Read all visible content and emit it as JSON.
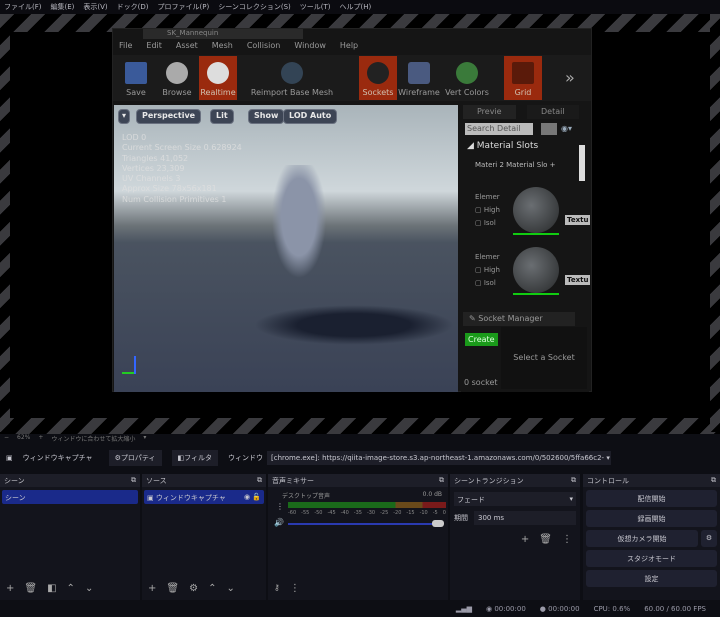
{
  "menubar": [
    "ファイル(F)",
    "編集(E)",
    "表示(V)",
    "ドック(D)",
    "プロファイル(P)",
    "シーンコレクション(S)",
    "ツール(T)",
    "ヘルプ(H)"
  ],
  "ue": {
    "title": "SK_Mannequin",
    "menu": [
      "File",
      "Edit",
      "Asset",
      "Mesh",
      "Collision",
      "Window",
      "Help"
    ],
    "toolbar": [
      {
        "label": "Save",
        "on": false
      },
      {
        "label": "Browse",
        "on": false
      },
      {
        "label": "Realtime",
        "on": true
      },
      {
        "label": "Reimport Base Mesh",
        "on": false
      },
      {
        "label": "Sockets",
        "on": true
      },
      {
        "label": "Wireframe",
        "on": false
      },
      {
        "label": "Vert Colors",
        "on": false
      },
      {
        "label": "Grid",
        "on": true
      }
    ],
    "more": "»",
    "viewport_buttons": {
      "dropdown": "▾",
      "perspective": "Perspective",
      "lit": "Lit",
      "show": "Show",
      "lod": "LOD Auto"
    },
    "stats": [
      "LOD  0",
      "Current Screen Size  0.628924",
      "Triangles  41,052",
      "Vertices  23,309",
      "UV Channels  3",
      "Approx Size  78x56x181",
      "Num Collision Primitives  1"
    ],
    "tabs": [
      "Previe",
      "Detail"
    ],
    "search_placeholder": "Search Detail",
    "material_slots": "Material Slots",
    "materials_label": "Materi",
    "materials_count": "2 Material Slo",
    "element": "Elemer",
    "highlight": "High",
    "isolate": "Isol",
    "texture": "Textu",
    "socket_manager": "Socket Manager",
    "create": "Create",
    "select_socket": "Select a Socket",
    "socket_count": "0 socket"
  },
  "zoombar": {
    "minus": "−",
    "zoom": "62%",
    "plus": "+",
    "fit": "ウィンドウに合わせて拡大縮小",
    "arrow": "▾"
  },
  "sourcebar": {
    "name": "ウィンドウキャプチャ",
    "properties": "プロパティ",
    "filters": "フィルタ",
    "window_label": "ウィンドウ",
    "window_value": "[chrome.exe]: https://qiita-image-store.s3.ap-northeast-1.amazonaws.com/0/502600/5ffa66c2-"
  },
  "docks": {
    "scenes": {
      "title": "シーン",
      "items": [
        "シーン"
      ]
    },
    "sources": {
      "title": "ソース",
      "items": [
        "ウィンドウキャプチャ"
      ]
    },
    "mixer": {
      "title": "音声ミキサー",
      "channel": "デスクトップ音声",
      "db": "0.0 dB",
      "ticks": [
        "-60",
        "-55",
        "-50",
        "-45",
        "-40",
        "-35",
        "-30",
        "-25",
        "-20",
        "-15",
        "-10",
        "-5",
        "0"
      ],
      "volume": 1.0
    },
    "transitions": {
      "title": "シーントランジション",
      "type": "フェード",
      "duration_label": "期間",
      "duration": "300 ms"
    },
    "controls": {
      "title": "コントロール",
      "buttons": [
        "配信開始",
        "録画開始",
        "仮想カメラ開始",
        "スタジオモード",
        "設定"
      ]
    }
  },
  "status": {
    "stream_time": "00:00:00",
    "rec_time": "00:00:00",
    "cpu": "CPU: 0.6%",
    "fps": "60.00 / 60.00 FPS"
  }
}
